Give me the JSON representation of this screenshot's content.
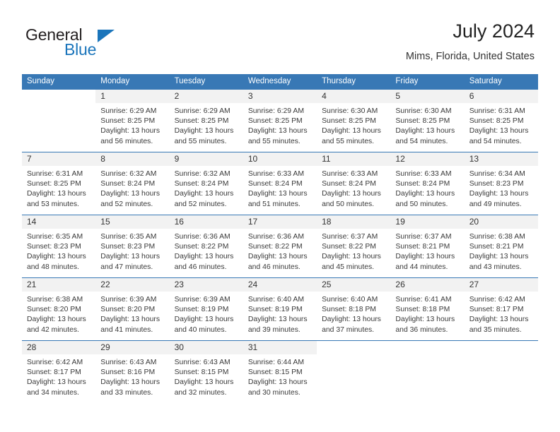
{
  "brand": {
    "word_one": "General",
    "word_two": "Blue",
    "logo_color": "#1b75bb"
  },
  "header": {
    "title": "July 2024",
    "subtitle": "Mims, Florida, United States",
    "accent_color": "#3878b5"
  },
  "weekdays": [
    "Sunday",
    "Monday",
    "Tuesday",
    "Wednesday",
    "Thursday",
    "Friday",
    "Saturday"
  ],
  "labels": {
    "sunrise_prefix": "Sunrise:",
    "sunset_prefix": "Sunset:",
    "daylight_prefix": "Daylight:"
  },
  "weeks": [
    [
      {
        "day": "",
        "sunrise": "",
        "sunset": "",
        "daylight_line1": "",
        "daylight_line2": "",
        "blank": true
      },
      {
        "day": "1",
        "sunrise": "Sunrise: 6:29 AM",
        "sunset": "Sunset: 8:25 PM",
        "daylight_line1": "Daylight: 13 hours",
        "daylight_line2": "and 56 minutes."
      },
      {
        "day": "2",
        "sunrise": "Sunrise: 6:29 AM",
        "sunset": "Sunset: 8:25 PM",
        "daylight_line1": "Daylight: 13 hours",
        "daylight_line2": "and 55 minutes."
      },
      {
        "day": "3",
        "sunrise": "Sunrise: 6:29 AM",
        "sunset": "Sunset: 8:25 PM",
        "daylight_line1": "Daylight: 13 hours",
        "daylight_line2": "and 55 minutes."
      },
      {
        "day": "4",
        "sunrise": "Sunrise: 6:30 AM",
        "sunset": "Sunset: 8:25 PM",
        "daylight_line1": "Daylight: 13 hours",
        "daylight_line2": "and 55 minutes."
      },
      {
        "day": "5",
        "sunrise": "Sunrise: 6:30 AM",
        "sunset": "Sunset: 8:25 PM",
        "daylight_line1": "Daylight: 13 hours",
        "daylight_line2": "and 54 minutes."
      },
      {
        "day": "6",
        "sunrise": "Sunrise: 6:31 AM",
        "sunset": "Sunset: 8:25 PM",
        "daylight_line1": "Daylight: 13 hours",
        "daylight_line2": "and 54 minutes."
      }
    ],
    [
      {
        "day": "7",
        "sunrise": "Sunrise: 6:31 AM",
        "sunset": "Sunset: 8:25 PM",
        "daylight_line1": "Daylight: 13 hours",
        "daylight_line2": "and 53 minutes."
      },
      {
        "day": "8",
        "sunrise": "Sunrise: 6:32 AM",
        "sunset": "Sunset: 8:24 PM",
        "daylight_line1": "Daylight: 13 hours",
        "daylight_line2": "and 52 minutes."
      },
      {
        "day": "9",
        "sunrise": "Sunrise: 6:32 AM",
        "sunset": "Sunset: 8:24 PM",
        "daylight_line1": "Daylight: 13 hours",
        "daylight_line2": "and 52 minutes."
      },
      {
        "day": "10",
        "sunrise": "Sunrise: 6:33 AM",
        "sunset": "Sunset: 8:24 PM",
        "daylight_line1": "Daylight: 13 hours",
        "daylight_line2": "and 51 minutes."
      },
      {
        "day": "11",
        "sunrise": "Sunrise: 6:33 AM",
        "sunset": "Sunset: 8:24 PM",
        "daylight_line1": "Daylight: 13 hours",
        "daylight_line2": "and 50 minutes."
      },
      {
        "day": "12",
        "sunrise": "Sunrise: 6:33 AM",
        "sunset": "Sunset: 8:24 PM",
        "daylight_line1": "Daylight: 13 hours",
        "daylight_line2": "and 50 minutes."
      },
      {
        "day": "13",
        "sunrise": "Sunrise: 6:34 AM",
        "sunset": "Sunset: 8:23 PM",
        "daylight_line1": "Daylight: 13 hours",
        "daylight_line2": "and 49 minutes."
      }
    ],
    [
      {
        "day": "14",
        "sunrise": "Sunrise: 6:35 AM",
        "sunset": "Sunset: 8:23 PM",
        "daylight_line1": "Daylight: 13 hours",
        "daylight_line2": "and 48 minutes."
      },
      {
        "day": "15",
        "sunrise": "Sunrise: 6:35 AM",
        "sunset": "Sunset: 8:23 PM",
        "daylight_line1": "Daylight: 13 hours",
        "daylight_line2": "and 47 minutes."
      },
      {
        "day": "16",
        "sunrise": "Sunrise: 6:36 AM",
        "sunset": "Sunset: 8:22 PM",
        "daylight_line1": "Daylight: 13 hours",
        "daylight_line2": "and 46 minutes."
      },
      {
        "day": "17",
        "sunrise": "Sunrise: 6:36 AM",
        "sunset": "Sunset: 8:22 PM",
        "daylight_line1": "Daylight: 13 hours",
        "daylight_line2": "and 46 minutes."
      },
      {
        "day": "18",
        "sunrise": "Sunrise: 6:37 AM",
        "sunset": "Sunset: 8:22 PM",
        "daylight_line1": "Daylight: 13 hours",
        "daylight_line2": "and 45 minutes."
      },
      {
        "day": "19",
        "sunrise": "Sunrise: 6:37 AM",
        "sunset": "Sunset: 8:21 PM",
        "daylight_line1": "Daylight: 13 hours",
        "daylight_line2": "and 44 minutes."
      },
      {
        "day": "20",
        "sunrise": "Sunrise: 6:38 AM",
        "sunset": "Sunset: 8:21 PM",
        "daylight_line1": "Daylight: 13 hours",
        "daylight_line2": "and 43 minutes."
      }
    ],
    [
      {
        "day": "21",
        "sunrise": "Sunrise: 6:38 AM",
        "sunset": "Sunset: 8:20 PM",
        "daylight_line1": "Daylight: 13 hours",
        "daylight_line2": "and 42 minutes."
      },
      {
        "day": "22",
        "sunrise": "Sunrise: 6:39 AM",
        "sunset": "Sunset: 8:20 PM",
        "daylight_line1": "Daylight: 13 hours",
        "daylight_line2": "and 41 minutes."
      },
      {
        "day": "23",
        "sunrise": "Sunrise: 6:39 AM",
        "sunset": "Sunset: 8:19 PM",
        "daylight_line1": "Daylight: 13 hours",
        "daylight_line2": "and 40 minutes."
      },
      {
        "day": "24",
        "sunrise": "Sunrise: 6:40 AM",
        "sunset": "Sunset: 8:19 PM",
        "daylight_line1": "Daylight: 13 hours",
        "daylight_line2": "and 39 minutes."
      },
      {
        "day": "25",
        "sunrise": "Sunrise: 6:40 AM",
        "sunset": "Sunset: 8:18 PM",
        "daylight_line1": "Daylight: 13 hours",
        "daylight_line2": "and 37 minutes."
      },
      {
        "day": "26",
        "sunrise": "Sunrise: 6:41 AM",
        "sunset": "Sunset: 8:18 PM",
        "daylight_line1": "Daylight: 13 hours",
        "daylight_line2": "and 36 minutes."
      },
      {
        "day": "27",
        "sunrise": "Sunrise: 6:42 AM",
        "sunset": "Sunset: 8:17 PM",
        "daylight_line1": "Daylight: 13 hours",
        "daylight_line2": "and 35 minutes."
      }
    ],
    [
      {
        "day": "28",
        "sunrise": "Sunrise: 6:42 AM",
        "sunset": "Sunset: 8:17 PM",
        "daylight_line1": "Daylight: 13 hours",
        "daylight_line2": "and 34 minutes."
      },
      {
        "day": "29",
        "sunrise": "Sunrise: 6:43 AM",
        "sunset": "Sunset: 8:16 PM",
        "daylight_line1": "Daylight: 13 hours",
        "daylight_line2": "and 33 minutes."
      },
      {
        "day": "30",
        "sunrise": "Sunrise: 6:43 AM",
        "sunset": "Sunset: 8:15 PM",
        "daylight_line1": "Daylight: 13 hours",
        "daylight_line2": "and 32 minutes."
      },
      {
        "day": "31",
        "sunrise": "Sunrise: 6:44 AM",
        "sunset": "Sunset: 8:15 PM",
        "daylight_line1": "Daylight: 13 hours",
        "daylight_line2": "and 30 minutes."
      },
      {
        "day": "",
        "sunrise": "",
        "sunset": "",
        "daylight_line1": "",
        "daylight_line2": "",
        "blank": true
      },
      {
        "day": "",
        "sunrise": "",
        "sunset": "",
        "daylight_line1": "",
        "daylight_line2": "",
        "blank": true
      },
      {
        "day": "",
        "sunrise": "",
        "sunset": "",
        "daylight_line1": "",
        "daylight_line2": "",
        "blank": true
      }
    ]
  ]
}
